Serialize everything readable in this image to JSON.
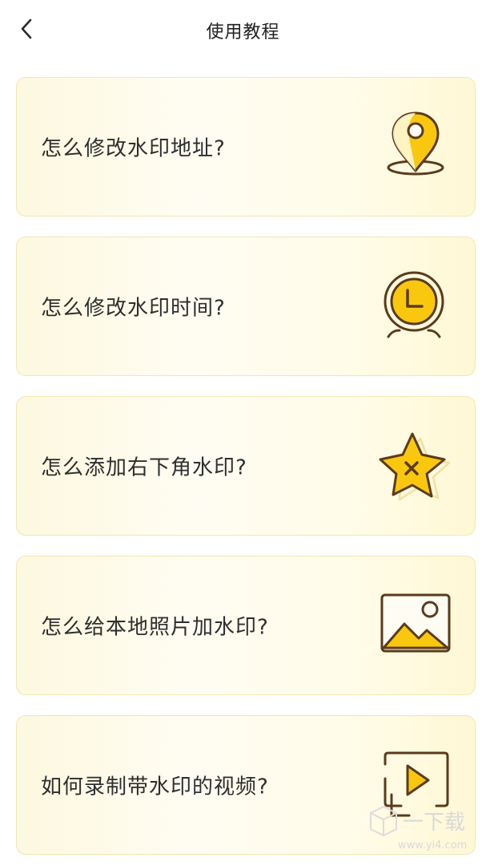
{
  "header": {
    "title": "使用教程",
    "back_icon": "chevron-left-icon"
  },
  "tutorials": [
    {
      "label": "怎么修改水印地址?",
      "icon": "location-pin-icon"
    },
    {
      "label": "怎么修改水印时间?",
      "icon": "alarm-clock-icon"
    },
    {
      "label": "怎么添加右下角水印?",
      "icon": "star-corner-icon"
    },
    {
      "label": "怎么给本地照片加水印?",
      "icon": "image-photo-icon"
    },
    {
      "label": "如何录制带水印的视频?",
      "icon": "video-play-icon"
    }
  ],
  "colors": {
    "accent_yellow": "#f9c80e",
    "icon_stroke": "#5a3b1c",
    "card_border": "#f1e7b3"
  },
  "watermark": {
    "text": "一下载",
    "url": "www.yi4.com"
  }
}
